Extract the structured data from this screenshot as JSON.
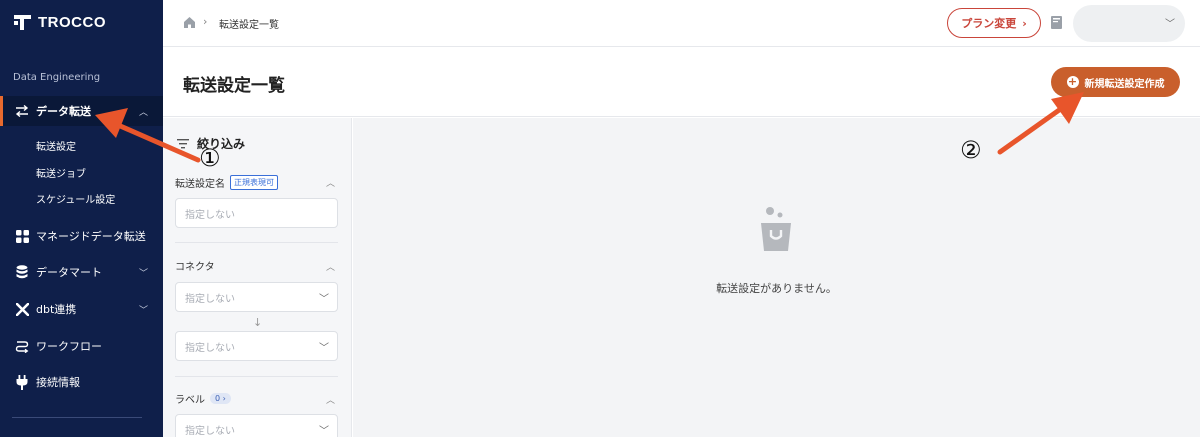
{
  "brand": {
    "name": "TROCCO"
  },
  "sidebar": {
    "section_label": "Data Engineering",
    "items": [
      {
        "label": "データ転送",
        "icon": "transfer-icon",
        "expanded": true
      },
      {
        "label": "マネージドデータ転送",
        "icon": "grid-icon"
      },
      {
        "label": "データマート",
        "icon": "database-icon"
      },
      {
        "label": "dbt連携",
        "icon": "dbt-icon"
      },
      {
        "label": "ワークフロー",
        "icon": "workflow-icon"
      },
      {
        "label": "接続情報",
        "icon": "plug-icon"
      }
    ],
    "sub_items": [
      {
        "label": "転送設定"
      },
      {
        "label": "転送ジョブ"
      },
      {
        "label": "スケジュール設定"
      }
    ]
  },
  "topbar": {
    "breadcrumb": "転送設定一覧",
    "plan_button": "プラン変更",
    "user_name": ""
  },
  "page": {
    "title": "転送設定一覧",
    "new_button": "新規転送設定作成"
  },
  "filter": {
    "title": "絞り込み",
    "name_label": "転送設定名",
    "regex_tag": "正規表現可",
    "name_placeholder": "指定しない",
    "connector_label": "コネクタ",
    "connector_from": "指定しない",
    "connector_to": "指定しない",
    "label_label": "ラベル",
    "label_count": "0",
    "label_placeholder": "指定しない"
  },
  "main": {
    "empty_message": "転送設定がありません。"
  },
  "annotations": {
    "one": "①",
    "two": "②",
    "arrow_color": "#e8552b"
  },
  "colors": {
    "sidebar_bg": "#0f1f4a",
    "accent": "#c95f2c",
    "plan_red": "#c9453a"
  }
}
